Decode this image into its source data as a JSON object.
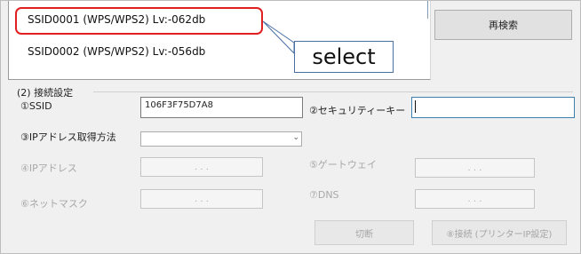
{
  "ssid_list": {
    "items": [
      {
        "label": "SSID0001 (WPS/WPS2) Lv:-062db"
      },
      {
        "label": "SSID0002 (WPS/WPS2) Lv:-056db"
      }
    ]
  },
  "callout": {
    "text": "select",
    "color": "#e02020"
  },
  "rescan_button": {
    "label": "再検索"
  },
  "connection_settings": {
    "title": "(2) 接続設定",
    "ssid_label": "①SSID",
    "ssid_value": "106F3F75D7A8",
    "security_key_label": "②セキュリティーキー",
    "security_key_value": "",
    "ip_method_label": "③IPアドレス取得方法",
    "ip_method_value": "",
    "ip_address_label": "④IPアドレス",
    "gateway_label": "⑤ゲートウェイ",
    "netmask_label": "⑥ネットマスク",
    "dns_label": "⑦DNS",
    "ip_placeholder": ".    .    .",
    "disconnect_label": "切断",
    "connect_label": "⑧接続 (プリンターIP設定)"
  },
  "colors": {
    "disabled_text": "#a8a8a8",
    "highlight": "#e02020",
    "callout_border": "#4a6fa5"
  }
}
